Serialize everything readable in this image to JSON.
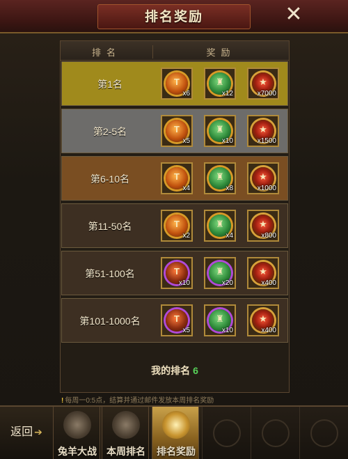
{
  "title": "排名奖励",
  "close_label": "✕",
  "table_header": {
    "rank": "排名",
    "reward": "奖励"
  },
  "rows": [
    {
      "rank": "第1名",
      "bg": "#a08a1c",
      "items": [
        {
          "icon": "red-hammer-medal-icon",
          "glyph": "T",
          "qty": "x6"
        },
        {
          "icon": "green-armor-medal-icon",
          "glyph": "♜",
          "qty": "x12"
        },
        {
          "icon": "star-emblem-icon",
          "glyph": "★",
          "qty": "x7000"
        }
      ]
    },
    {
      "rank": "第2-5名",
      "bg": "#6d6c6a",
      "items": [
        {
          "icon": "red-hammer-medal-icon",
          "glyph": "T",
          "qty": "x5"
        },
        {
          "icon": "green-armor-medal-icon",
          "glyph": "♜",
          "qty": "x10"
        },
        {
          "icon": "star-emblem-icon",
          "glyph": "★",
          "qty": "x1500"
        }
      ]
    },
    {
      "rank": "第6-10名",
      "bg": "#7a4e22",
      "items": [
        {
          "icon": "red-hammer-medal-icon",
          "glyph": "T",
          "qty": "x4"
        },
        {
          "icon": "green-armor-medal-icon",
          "glyph": "♜",
          "qty": "x8"
        },
        {
          "icon": "star-emblem-icon",
          "glyph": "★",
          "qty": "x1000"
        }
      ]
    },
    {
      "rank": "第11-50名",
      "bg": "#3d2f22",
      "items": [
        {
          "icon": "red-hammer-medal-icon",
          "glyph": "T",
          "qty": "x2"
        },
        {
          "icon": "green-armor-medal-icon",
          "glyph": "♜",
          "qty": "x4"
        },
        {
          "icon": "star-emblem-icon",
          "glyph": "★",
          "qty": "x800"
        }
      ]
    },
    {
      "rank": "第51-100名",
      "bg": "#3d2f22",
      "items": [
        {
          "icon": "purple-hammer-medal-icon",
          "glyph": "T",
          "qty": "x10"
        },
        {
          "icon": "purple-armor-medal-icon",
          "glyph": "♜",
          "qty": "x20"
        },
        {
          "icon": "star-emblem-icon",
          "glyph": "★",
          "qty": "x400"
        }
      ]
    },
    {
      "rank": "第101-1000名",
      "bg": "#3d2f22",
      "items": [
        {
          "icon": "purple-hammer-medal-icon",
          "glyph": "T",
          "qty": "x5"
        },
        {
          "icon": "purple-armor-medal-icon",
          "glyph": "♜",
          "qty": "x10"
        },
        {
          "icon": "star-emblem-icon",
          "glyph": "★",
          "qty": "x400"
        }
      ]
    }
  ],
  "my_rank": {
    "label": "我的排名",
    "value": "6"
  },
  "notice": "每周一0:5点，结算并通过邮件发放本周排名奖励",
  "bottom": {
    "back_label": "返回",
    "tabs": [
      {
        "label": "兔羊大战",
        "icon": "ram-skull-icon",
        "active": false
      },
      {
        "label": "本周排名",
        "icon": "beast-head-icon",
        "active": false
      },
      {
        "label": "排名奖励",
        "icon": "trophy-icon",
        "active": true
      }
    ]
  }
}
